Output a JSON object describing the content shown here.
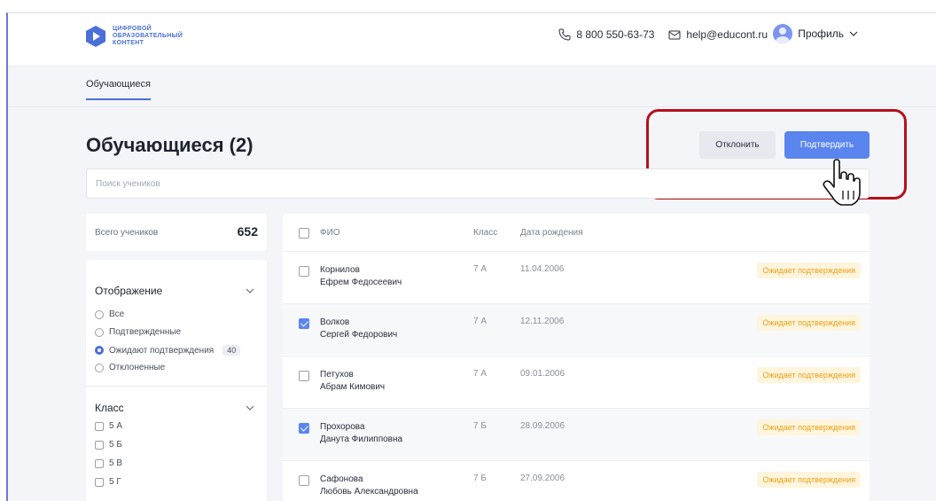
{
  "header": {
    "logo_lines": [
      "ЦИФРОВОЙ",
      "ОБРАЗОВАТЕЛЬНЫЙ",
      "КОНТЕНТ"
    ],
    "phone": "8 800 550-63-73",
    "email": "help@educont.ru",
    "profile_label": "Профиль"
  },
  "subnav": {
    "active_tab": "Обучающиеся"
  },
  "page": {
    "title": "Обучающиеся (2)",
    "reject_label": "Отклонить",
    "confirm_label": "Подтвердить",
    "search_placeholder": "Поиск учеников"
  },
  "summary": {
    "label": "Всего учеников",
    "value": "652"
  },
  "filters": {
    "display": {
      "title": "Отображение",
      "options": [
        {
          "label": "Все",
          "selected": false
        },
        {
          "label": "Подтвержденные",
          "selected": false
        },
        {
          "label": "Ожидают подтверждения",
          "selected": true,
          "count": "40"
        },
        {
          "label": "Отклоненные",
          "selected": false
        }
      ]
    },
    "class": {
      "title": "Класс",
      "options": [
        "5 А",
        "5 Б",
        "5 В",
        "5 Г"
      ]
    }
  },
  "table": {
    "headers": {
      "name": "ФИО",
      "class": "Класс",
      "dob": "Дата рождения"
    },
    "rows": [
      {
        "last": "Корнилов",
        "first": "Ефрем Федосеевич",
        "class": "7 А",
        "dob": "11.04.2006",
        "status": "Ожидает подтверждения",
        "checked": false
      },
      {
        "last": "Волков",
        "first": "Сергей Федорович",
        "class": "7 А",
        "dob": "12.11.2006",
        "status": "Ожидает подтверждения",
        "checked": true
      },
      {
        "last": "Петухов",
        "first": "Абрам Кимович",
        "class": "7 А",
        "dob": "09.01.2006",
        "status": "Ожидает подтверждения",
        "checked": false
      },
      {
        "last": "Прохорова",
        "first": "Данута Филипповна",
        "class": "7 Б",
        "dob": "28.09.2006",
        "status": "Ожидает подтверждения",
        "checked": true
      },
      {
        "last": "Сафонова",
        "first": "Любовь Александровна",
        "class": "7 Б",
        "dob": "27.09.2006",
        "status": "Ожидает подтверждения",
        "checked": false
      }
    ]
  },
  "colors": {
    "accent": "#5a85ef",
    "highlight": "#b3121c",
    "status": "#e6a118"
  }
}
